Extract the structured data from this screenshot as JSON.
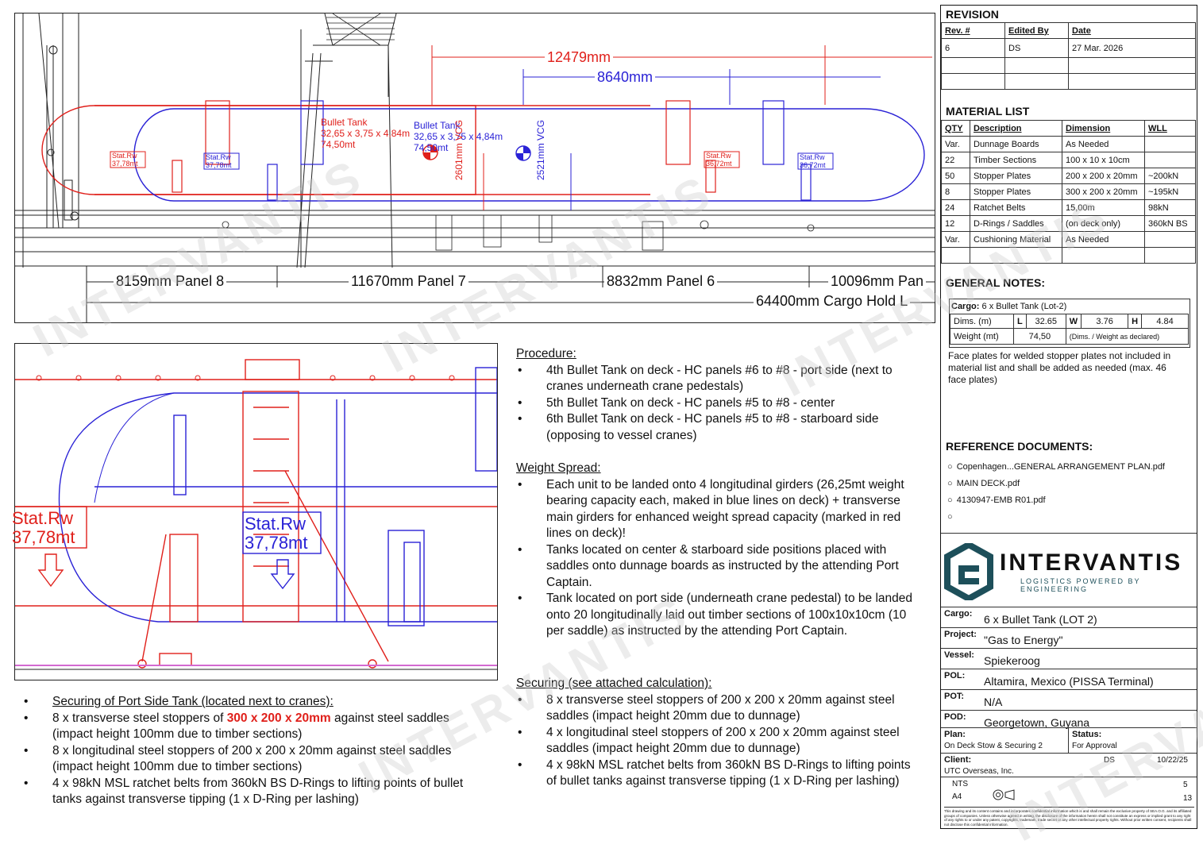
{
  "revision": {
    "title": "REVISION",
    "headers": [
      "Rev. #",
      "Edited By",
      "Date"
    ],
    "rows": [
      [
        "6",
        "DS",
        "27 Mar. 2026"
      ],
      [
        "",
        "",
        ""
      ],
      [
        "",
        "",
        ""
      ]
    ]
  },
  "material": {
    "title": "MATERIAL LIST",
    "headers": [
      "QTY",
      "Description",
      "Dimension",
      "WLL"
    ],
    "rows": [
      [
        "Var.",
        "Dunnage Boards",
        "As Needed",
        ""
      ],
      [
        "22",
        "Timber Sections",
        "100 x 10 x 10cm",
        ""
      ],
      [
        "50",
        "Stopper Plates",
        "200 x 200 x 20mm",
        "~200kN"
      ],
      [
        "8",
        "Stopper Plates",
        "300 x 200 x 20mm",
        "~195kN"
      ],
      [
        "24",
        "Ratchet Belts",
        "15,00m",
        "98kN"
      ],
      [
        "12",
        "D-Rings / Saddles",
        "(on deck only)",
        "360kN BS"
      ],
      [
        "Var.",
        "Cushioning Material",
        "As Needed",
        ""
      ],
      [
        "",
        "",
        "",
        ""
      ]
    ]
  },
  "general_notes": {
    "title": "GENERAL NOTES:",
    "cargo_label": "Cargo:",
    "cargo_value": "6 x Bullet Tank (Lot-2)",
    "dims_label": "Dims. (m)",
    "L": "L",
    "L_val": "32.65",
    "W": "W",
    "W_val": "3.76",
    "H": "H",
    "H_val": "4.84",
    "weight_label": "Weight (mt)",
    "weight_val": "74,50",
    "weight_note": "(Dims. / Weight as declared)",
    "note": "Face plates for welded stopper plates not included in material list and shall be added as needed (max. 46 face plates)"
  },
  "reference": {
    "title": "REFERENCE DOCUMENTS:",
    "items": [
      "Copenhagen...GENERAL ARRANGEMENT PLAN.pdf",
      "MAIN DECK.pdf",
      "4130947-EMB R01.pdf",
      ""
    ]
  },
  "logo": {
    "name": "INTERVANTIS",
    "tagline": "LOGISTICS POWERED BY ENGINEERING"
  },
  "info": [
    {
      "k": "Cargo:",
      "v": "6 x Bullet Tank (LOT 2)"
    },
    {
      "k": "Project:",
      "v": "\"Gas to Energy\""
    },
    {
      "k": "Vessel:",
      "v": "Spiekeroog"
    },
    {
      "k": "POL:",
      "v": "Altamira, Mexico (PISSA Terminal)"
    },
    {
      "k": "POT:",
      "v": "N/A"
    },
    {
      "k": "POD:",
      "v": "Georgetown, Guyana"
    }
  ],
  "plan": {
    "plan_label": "Plan:",
    "plan_value": "On Deck Stow & Securing 2",
    "status_label": "Status:",
    "status_value": "For Approval",
    "client_label": "Client:",
    "client_value": "UTC Overseas, Inc.",
    "drawn_by": "DS",
    "date": "10/22/25",
    "scale_value": "NTS",
    "format_value": "A4",
    "sheet": "5",
    "of": "13",
    "disclaimer": "This drawing and its content contains and incorporates confidential information which is and shall remain the exclusive property of SEA.O.G. and its affiliated groups of companies. Unless otherwise agreed in writing, the disclosure of the information herein shall not constitute an express or implied grant to any right of any rights to or under any patent, copyrights, trademark, trade secret or any other intellectual property rights. Without prior written consent, recipients shall not disclose this confidential information."
  },
  "drawing_top": {
    "dim_total": "12479mm",
    "dim_inner": "8640mm",
    "tank1": "Bullet Tank\n32,65 x 3,75 x 4,84m\n74,50mt",
    "tank2": "Bullet Tank\n32,65 x 3,75 x 4,84m\n74,50mt",
    "vcg1": "2601mm VCG",
    "vcg2": "2521mm VCG",
    "stat1": "Stat.Rw\n37,78mt",
    "stat2": "Stat.Rw\n37,78mt",
    "stat3": "Stat.Rw\n36,72mt",
    "stat4": "Stat.Rw\n36,72mt",
    "panel8": "8159mm Panel 8",
    "panel7": "11670mm Panel 7",
    "panel6": "8832mm Panel 6",
    "panel5": "10096mm Pan",
    "hold": "64400mm Cargo Hold L"
  },
  "drawing_detail": {
    "stat_red": "Stat.Rw\n37,78mt",
    "stat_blue": "Stat.Rw\n37,78mt"
  },
  "procedure": {
    "title": "Procedure:",
    "items": [
      "4th Bullet Tank on deck - HC panels #6 to #8 -  port side (next to cranes underneath crane pedestals)",
      "5th Bullet Tank on deck - HC panels #5 to #8 - center",
      "6th Bullet Tank on deck - HC panels #5 to #8 - starboard side (opposing to vessel cranes)"
    ]
  },
  "weight_spread": {
    "title": "Weight Spread:",
    "items": [
      "Each unit to be landed onto 4 longitudinal girders (26,25mt weight bearing capacity each, maked in blue lines on deck) + transverse main girders for enhanced weight spread capacity (marked in red lines on deck)!",
      "Tanks located on center & starboard side positions placed with saddles onto dunnage boards as instructed by the attending Port Captain.",
      "Tank located on port side (underneath crane pedestal) to be landed onto 20 longitudinally laid out timber sections of 100x10x10cm (10 per saddle) as instructed by the attending Port Captain."
    ]
  },
  "securing": {
    "title": "Securing (see attached calculation):",
    "items": [
      "8 x transverse steel stoppers of 200 x 200 x 20mm against steel saddles (impact height 20mm due to dunnage)",
      "4 x longitudinal steel stoppers of 200 x 200 x 20mm against steel saddles (impact height 20mm due to dunnage)",
      "4 x 98kN MSL ratchet belts from 360kN BS D-Rings to lifting points of bullet tanks against transverse tipping (1 x D-Ring per lashing)"
    ]
  },
  "port_side": {
    "title": "Securing of Port Side Tank (located next to cranes):",
    "item1_pre": "8 x transverse steel stoppers of ",
    "item1_red": "300 x 200 x 20mm",
    "item1_post": " against steel saddles (impact height 100mm due to timber sections)",
    "item2": "8 x longitudinal steel stoppers of 200 x 200 x 20mm against steel saddles (impact height 100mm due to timber sections)",
    "item3": "4 x 98kN MSL ratchet belts from 360kN BS D-Rings to lifting points of bullet tanks against transverse tipping (1 x D-Ring per lashing)"
  },
  "colors": {
    "red": "#e0201b",
    "blue": "#2a22d6",
    "teal": "#1d4f5a"
  }
}
